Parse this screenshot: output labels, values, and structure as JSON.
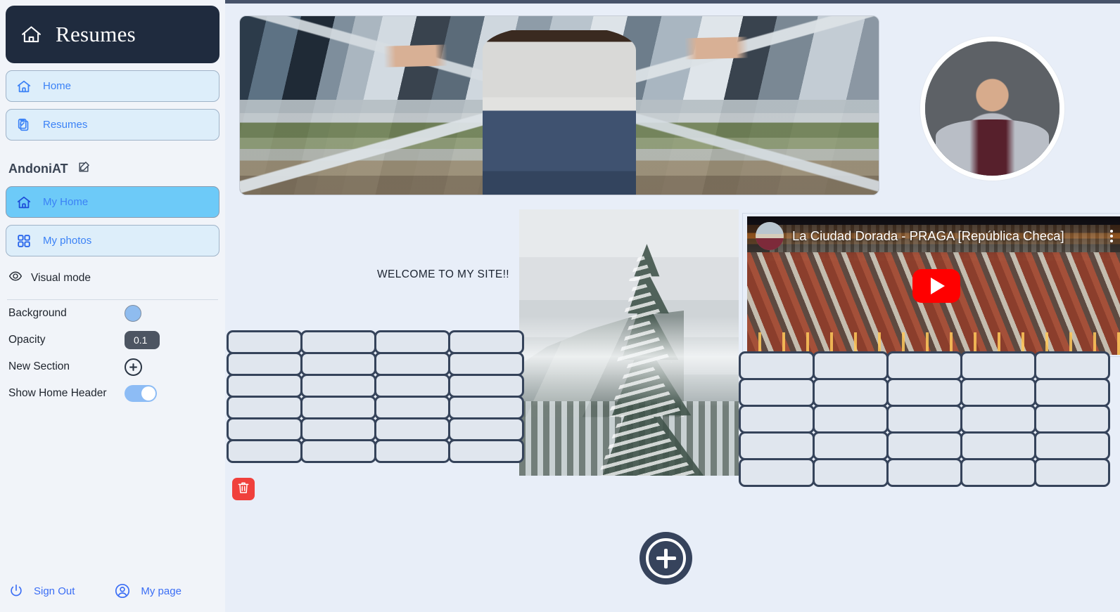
{
  "sidebar": {
    "brand": {
      "title": "Resumes",
      "icon": "home-outline-icon"
    },
    "nav": [
      {
        "label": "Home",
        "icon": "home-icon",
        "active": false
      },
      {
        "label": "Resumes",
        "icon": "clipboard-check-icon",
        "active": false
      }
    ],
    "user": {
      "name": "AndoniAT",
      "edit_icon": "pencil-square-icon"
    },
    "pages": [
      {
        "label": "My Home",
        "icon": "home-icon",
        "active": true
      },
      {
        "label": "My photos",
        "icon": "grid-squares-icon",
        "active": false
      }
    ],
    "visual_mode": {
      "label": "Visual mode",
      "icon": "eye-icon"
    },
    "controls": [
      {
        "label": "Background",
        "type": "color-swatch",
        "value": "#8fbcef"
      },
      {
        "label": "Opacity",
        "type": "number-field",
        "value": "0.1"
      },
      {
        "label": "New Section",
        "type": "add-button",
        "icon": "plus-circle-icon"
      },
      {
        "label": "Show Home Header",
        "type": "toggle",
        "value": "on"
      }
    ],
    "footer": [
      {
        "label": "Sign Out",
        "icon": "power-icon"
      },
      {
        "label": "My page",
        "icon": "account-circle-icon"
      }
    ]
  },
  "main": {
    "banner": {
      "alt": "Person standing with arms outstretched on a rooftop walkway above a city skyline"
    },
    "avatar": {
      "alt": "Portrait of a young man wearing a flat cap and grey coat"
    },
    "welcome_text": "WELCOME TO MY SITE!!",
    "snow_image": {
      "alt": "Snow covered fir trees on a foggy mountainside"
    },
    "video": {
      "title": "La Ciudad Dorada - PRAGA [República Checa]",
      "play_icon": "youtube-play-icon",
      "menu_icon": "kebab-menu-icon",
      "channel_icon": "channel-avatar"
    },
    "grid_left": {
      "columns": 4,
      "rows": 6
    },
    "grid_right": {
      "columns": 5,
      "rows": 5
    },
    "delete_button": {
      "icon": "trash-icon"
    },
    "add_section_button": {
      "icon": "plus-icon"
    }
  },
  "colors": {
    "sidebar_bg": "#f1f4f9",
    "brand_bg": "#1f2b3e",
    "main_bg": "#e8eef8",
    "accent_blue": "#3b82f6",
    "active_pill": "#6dcaf8",
    "grid_border": "#35435a",
    "danger_red": "#f0403c",
    "fab_navy": "#36435c"
  }
}
